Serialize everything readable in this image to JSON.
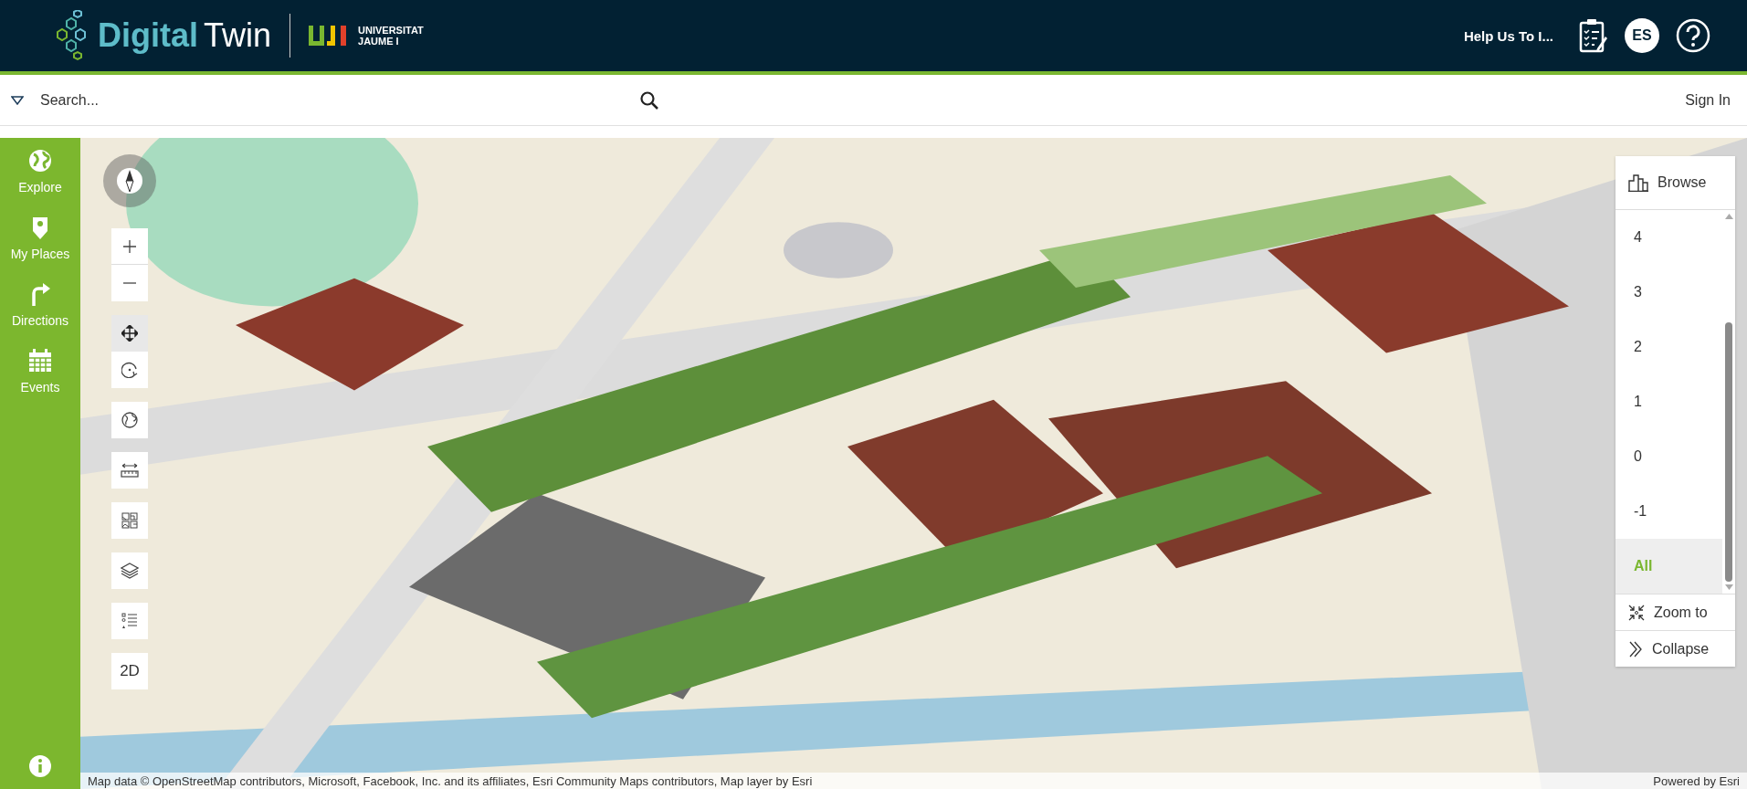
{
  "header": {
    "brand_left": "Digital",
    "brand_right": "Twin",
    "university_line1": "UNIVERSITAT",
    "university_line2": "JAUME I",
    "survey_link": "Help Us To I...",
    "language": "ES"
  },
  "search": {
    "placeholder": "Search...",
    "sign_in": "Sign In"
  },
  "sidebar": {
    "items": [
      {
        "label": "Explore",
        "kind": "globe"
      },
      {
        "label": "My Places",
        "kind": "pin"
      },
      {
        "label": "Directions",
        "kind": "turn"
      },
      {
        "label": "Events",
        "kind": "calendar"
      }
    ]
  },
  "map_tools": [
    {
      "kind": "zoom-in",
      "selected": false
    },
    {
      "kind": "zoom-out",
      "selected": false
    },
    {
      "kind": "pan",
      "selected": true
    },
    {
      "kind": "rotate",
      "selected": false
    },
    {
      "kind": "globe",
      "selected": false
    },
    {
      "kind": "measure",
      "selected": false
    },
    {
      "kind": "basemap",
      "selected": false
    },
    {
      "kind": "layers",
      "selected": false
    },
    {
      "kind": "legend",
      "selected": false
    },
    {
      "kind": "view",
      "label": "2D",
      "selected": false
    }
  ],
  "floor_panel": {
    "title": "Browse",
    "levels": [
      {
        "label": "4",
        "selected": false
      },
      {
        "label": "3",
        "selected": false
      },
      {
        "label": "2",
        "selected": false
      },
      {
        "label": "1",
        "selected": false
      },
      {
        "label": "0",
        "selected": false
      },
      {
        "label": "-1",
        "selected": false
      },
      {
        "label": "All",
        "selected": true
      }
    ],
    "actions": [
      {
        "kind": "zoom",
        "label": "Zoom to"
      },
      {
        "kind": "collapse",
        "label": "Collapse"
      }
    ]
  },
  "attribution": {
    "credits": "Map data © OpenStreetMap contributors, Microsoft, Facebook, Inc. and its affiliates, Esri Community Maps contributors, Map layer by Esri",
    "powered_by": "Powered by Esri"
  }
}
